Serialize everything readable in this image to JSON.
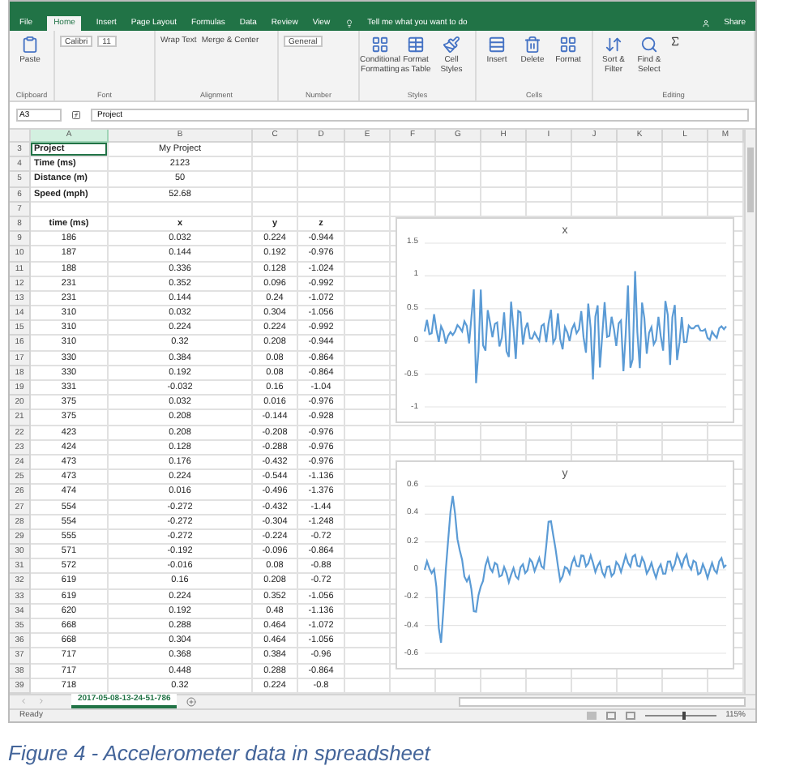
{
  "menu_tabs": [
    {
      "label": "File",
      "selected": false
    },
    {
      "label": "Home",
      "selected": true
    },
    {
      "label": "Insert",
      "selected": false
    },
    {
      "label": "Page Layout",
      "selected": false
    },
    {
      "label": "Formulas",
      "selected": false
    },
    {
      "label": "Data",
      "selected": false
    },
    {
      "label": "Review",
      "selected": false
    },
    {
      "label": "View",
      "selected": false
    }
  ],
  "tell_me": "Tell me what you want to do",
  "share": "Share",
  "ribbon_groups": [
    {
      "label": "Clipboard",
      "controls": [
        {
          "kind": "big",
          "label": "Paste"
        }
      ]
    },
    {
      "label": "Font",
      "controls": [
        {
          "kind": "field",
          "label": "Calibri"
        },
        {
          "kind": "field",
          "label": "11"
        }
      ]
    },
    {
      "label": "Alignment",
      "controls": [
        {
          "kind": "small",
          "label": "Wrap Text"
        },
        {
          "kind": "small",
          "label": "Merge & Center"
        }
      ]
    },
    {
      "label": "Number",
      "controls": [
        {
          "kind": "field",
          "label": "General"
        }
      ]
    },
    {
      "label": "Styles",
      "controls": [
        {
          "kind": "big",
          "label": "Conditional Formatting"
        },
        {
          "kind": "big",
          "label": "Format as Table"
        },
        {
          "kind": "big",
          "label": "Cell Styles"
        }
      ]
    },
    {
      "label": "Cells",
      "controls": [
        {
          "kind": "big",
          "label": "Insert"
        },
        {
          "kind": "big",
          "label": "Delete"
        },
        {
          "kind": "big",
          "label": "Format"
        }
      ]
    },
    {
      "label": "Editing",
      "controls": [
        {
          "kind": "big",
          "label": "Sort & Filter"
        },
        {
          "kind": "big",
          "label": "Find & Select"
        }
      ]
    }
  ],
  "name_box": "A3",
  "formula": "Project",
  "columns": [
    "A",
    "B",
    "C",
    "D",
    "E",
    "F",
    "G",
    "H",
    "I",
    "J",
    "K",
    "L",
    "M"
  ],
  "rows": [
    {
      "row": "3",
      "kind": "info",
      "a": "Project",
      "b": "My Project"
    },
    {
      "row": "4",
      "kind": "info",
      "a": "Time (ms)",
      "b": "2123"
    },
    {
      "row": "5",
      "kind": "info",
      "a": "Distance (m)",
      "b": "50"
    },
    {
      "row": "6",
      "kind": "info",
      "a": "Speed (mph)",
      "b": "52.68"
    },
    {
      "row": "7",
      "kind": "blank"
    },
    {
      "row": "8",
      "kind": "header",
      "a": "time (ms)",
      "b": "x",
      "c": "y",
      "d": "z"
    },
    {
      "row": "9",
      "kind": "data",
      "a": "186",
      "b": "0.032",
      "c": "0.224",
      "d": "-0.944"
    },
    {
      "row": "10",
      "kind": "data",
      "a": "187",
      "b": "0.144",
      "c": "0.192",
      "d": "-0.976"
    },
    {
      "row": "11",
      "kind": "data",
      "a": "188",
      "b": "0.336",
      "c": "0.128",
      "d": "-1.024"
    },
    {
      "row": "12",
      "kind": "data",
      "a": "231",
      "b": "0.352",
      "c": "0.096",
      "d": "-0.992"
    },
    {
      "row": "13",
      "kind": "data",
      "a": "231",
      "b": "0.144",
      "c": "0.24",
      "d": "-1.072"
    },
    {
      "row": "14",
      "kind": "data",
      "a": "310",
      "b": "0.032",
      "c": "0.304",
      "d": "-1.056"
    },
    {
      "row": "15",
      "kind": "data",
      "a": "310",
      "b": "0.224",
      "c": "0.224",
      "d": "-0.992"
    },
    {
      "row": "16",
      "kind": "data",
      "a": "310",
      "b": "0.32",
      "c": "0.208",
      "d": "-0.944"
    },
    {
      "row": "17",
      "kind": "data",
      "a": "330",
      "b": "0.384",
      "c": "0.08",
      "d": "-0.864"
    },
    {
      "row": "18",
      "kind": "data",
      "a": "330",
      "b": "0.192",
      "c": "0.08",
      "d": "-0.864"
    },
    {
      "row": "19",
      "kind": "data",
      "a": "331",
      "b": "-0.032",
      "c": "0.16",
      "d": "-1.04"
    },
    {
      "row": "20",
      "kind": "data",
      "a": "375",
      "b": "0.032",
      "c": "0.016",
      "d": "-0.976"
    },
    {
      "row": "21",
      "kind": "data",
      "a": "375",
      "b": "0.208",
      "c": "-0.144",
      "d": "-0.928"
    },
    {
      "row": "22",
      "kind": "data",
      "a": "423",
      "b": "0.208",
      "c": "-0.208",
      "d": "-0.976"
    },
    {
      "row": "23",
      "kind": "data",
      "a": "424",
      "b": "0.128",
      "c": "-0.288",
      "d": "-0.976"
    },
    {
      "row": "24",
      "kind": "data",
      "a": "473",
      "b": "0.176",
      "c": "-0.432",
      "d": "-0.976"
    },
    {
      "row": "25",
      "kind": "data",
      "a": "473",
      "b": "0.224",
      "c": "-0.544",
      "d": "-1.136"
    },
    {
      "row": "26",
      "kind": "data",
      "a": "474",
      "b": "0.016",
      "c": "-0.496",
      "d": "-1.376"
    },
    {
      "row": "27",
      "kind": "data",
      "a": "554",
      "b": "-0.272",
      "c": "-0.432",
      "d": "-1.44"
    },
    {
      "row": "28",
      "kind": "data",
      "a": "554",
      "b": "-0.272",
      "c": "-0.304",
      "d": "-1.248"
    },
    {
      "row": "29",
      "kind": "data",
      "a": "555",
      "b": "-0.272",
      "c": "-0.224",
      "d": "-0.72"
    },
    {
      "row": "30",
      "kind": "data",
      "a": "571",
      "b": "-0.192",
      "c": "-0.096",
      "d": "-0.864"
    },
    {
      "row": "31",
      "kind": "data",
      "a": "572",
      "b": "-0.016",
      "c": "0.08",
      "d": "-0.88"
    },
    {
      "row": "32",
      "kind": "data",
      "a": "619",
      "b": "0.16",
      "c": "0.208",
      "d": "-0.72"
    },
    {
      "row": "33",
      "kind": "data",
      "a": "619",
      "b": "0.224",
      "c": "0.352",
      "d": "-1.056"
    },
    {
      "row": "34",
      "kind": "data",
      "a": "620",
      "b": "0.192",
      "c": "0.48",
      "d": "-1.136"
    },
    {
      "row": "35",
      "kind": "data",
      "a": "668",
      "b": "0.288",
      "c": "0.464",
      "d": "-1.072"
    },
    {
      "row": "36",
      "kind": "data",
      "a": "668",
      "b": "0.304",
      "c": "0.464",
      "d": "-1.056"
    },
    {
      "row": "37",
      "kind": "data",
      "a": "717",
      "b": "0.368",
      "c": "0.384",
      "d": "-0.96"
    },
    {
      "row": "38",
      "kind": "data",
      "a": "717",
      "b": "0.448",
      "c": "0.288",
      "d": "-0.864"
    },
    {
      "row": "39",
      "kind": "data",
      "a": "718",
      "b": "0.32",
      "c": "0.224",
      "d": "-0.8"
    }
  ],
  "charts": [
    {
      "title": "x",
      "y_axis_labels": [
        "1.5",
        "1",
        "0.5",
        "0",
        "-0.5",
        "-1"
      ]
    },
    {
      "title": "y",
      "y_axis_labels": [
        "0.6",
        "0.4",
        "0.2",
        "0",
        "-0.2",
        "-0.4",
        "-0.6"
      ]
    }
  ],
  "sheet_tab": {
    "label": "2017-05-08-13-24-51-786",
    "selected": true
  },
  "status": "Ready",
  "zoom": "115%",
  "zoom_slider": {
    "level": 0.55
  },
  "caption": "Figure 4 - Accelerometer data in spreadsheet"
}
